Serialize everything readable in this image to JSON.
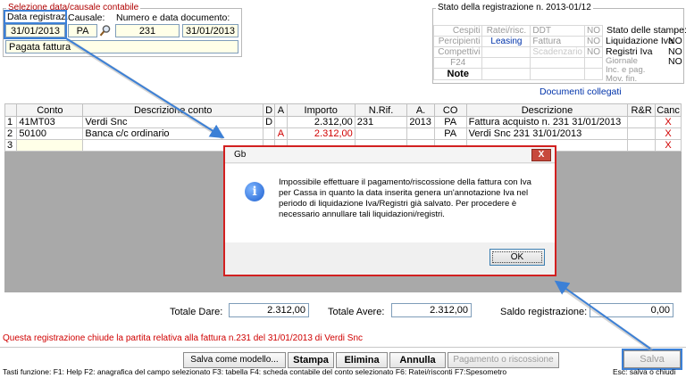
{
  "selezione": {
    "legend": "Selezione data/causale contabile",
    "data_label": "Data registraz.",
    "data_value": "31/01/2013",
    "causale_label": "Causale:",
    "causale_value": "PA",
    "numero_label": "Numero e data documento:",
    "numero_value": "231",
    "doc_date_value": "31/01/2013",
    "descrizione_value": "Pagata fattura"
  },
  "stato": {
    "legend": "Stato della registrazione n. 2013-01/12",
    "rows": [
      [
        "Cespiti",
        "Ratei/risc.",
        "DDT",
        "NO"
      ],
      [
        "Percipienti",
        "Leasing",
        "Fattura",
        "NO"
      ],
      [
        "Compettivi",
        "",
        "Scadenzario",
        "NO"
      ],
      [
        "F24",
        "",
        "",
        ""
      ],
      [
        "Note",
        "",
        "",
        ""
      ]
    ],
    "stampe_header": "Stato delle stampe:",
    "stampe": [
      [
        "Liquidazione Iva",
        "NO"
      ],
      [
        "Registri Iva",
        "NO"
      ],
      [
        "Giornale",
        "NO"
      ],
      [
        "Inc. e pag.",
        ""
      ],
      [
        "Mov. fin.",
        ""
      ]
    ],
    "documenti_link": "Documenti collegati"
  },
  "grid": {
    "headers": [
      "",
      "Conto",
      "Descrizione conto",
      "D",
      "A",
      "Importo",
      "N.Rif.",
      "A.",
      "CO",
      "Descrizione",
      "R&R",
      "Canc"
    ],
    "rows": [
      [
        "1",
        "41MT03",
        "Verdi Snc",
        "D",
        "",
        "2.312,00",
        "231",
        "2013",
        "PA",
        "Fattura acquisto n. 231 31/01/2013",
        "",
        "X"
      ],
      [
        "2",
        "50100",
        "Banca c/c ordinario",
        "",
        "A",
        "2.312,00",
        "",
        "",
        "PA",
        "Verdi Snc  231 31/01/2013",
        "",
        "X"
      ],
      [
        "3",
        "",
        "",
        "",
        "",
        "",
        "",
        "",
        "",
        "",
        "",
        "X"
      ]
    ]
  },
  "dialog": {
    "title": "Gb",
    "close_glyph": "X",
    "icon_glyph": "i",
    "message": "Impossibile effettuare il pagamento/riscossione della fattura con Iva per Cassa in quanto la data inserita genera un'annotazione Iva nel periodo di liquidazione Iva/Registri già salvato. Per procedere è necessario annullare tali liquidazioni/registri.",
    "ok_label": "OK"
  },
  "totali": {
    "dare_label": "Totale Dare:",
    "dare_value": "2.312,00",
    "avere_label": "Totale Avere:",
    "avere_value": "2.312,00",
    "saldo_label": "Saldo registrazione:",
    "saldo_value": "0,00"
  },
  "status_message": "Questa registrazione chiude la partita relativa alla fattura n.231 del 31/01/2013 di Verdi Snc",
  "toolbar": {
    "salva_modello": "Salva come modello...",
    "stampa": "Stampa",
    "elimina": "Elimina",
    "annulla": "Annulla",
    "pagamento": "Pagamento o riscossione",
    "salva": "Salva"
  },
  "footer": {
    "shortcuts": "Tasti funzione:  F1: Help  F2: anagrafica del campo selezionato   F3: tabella   F4: scheda contabile del conto selezionato    F6: Ratei/risconti     F7:Spesometro",
    "esc": "Esc: salva o chiudi"
  },
  "colors": {
    "highlight": "#3c80d6",
    "dialog_border": "#d22020",
    "error_text": "#d00000",
    "link": "#0033aa"
  }
}
